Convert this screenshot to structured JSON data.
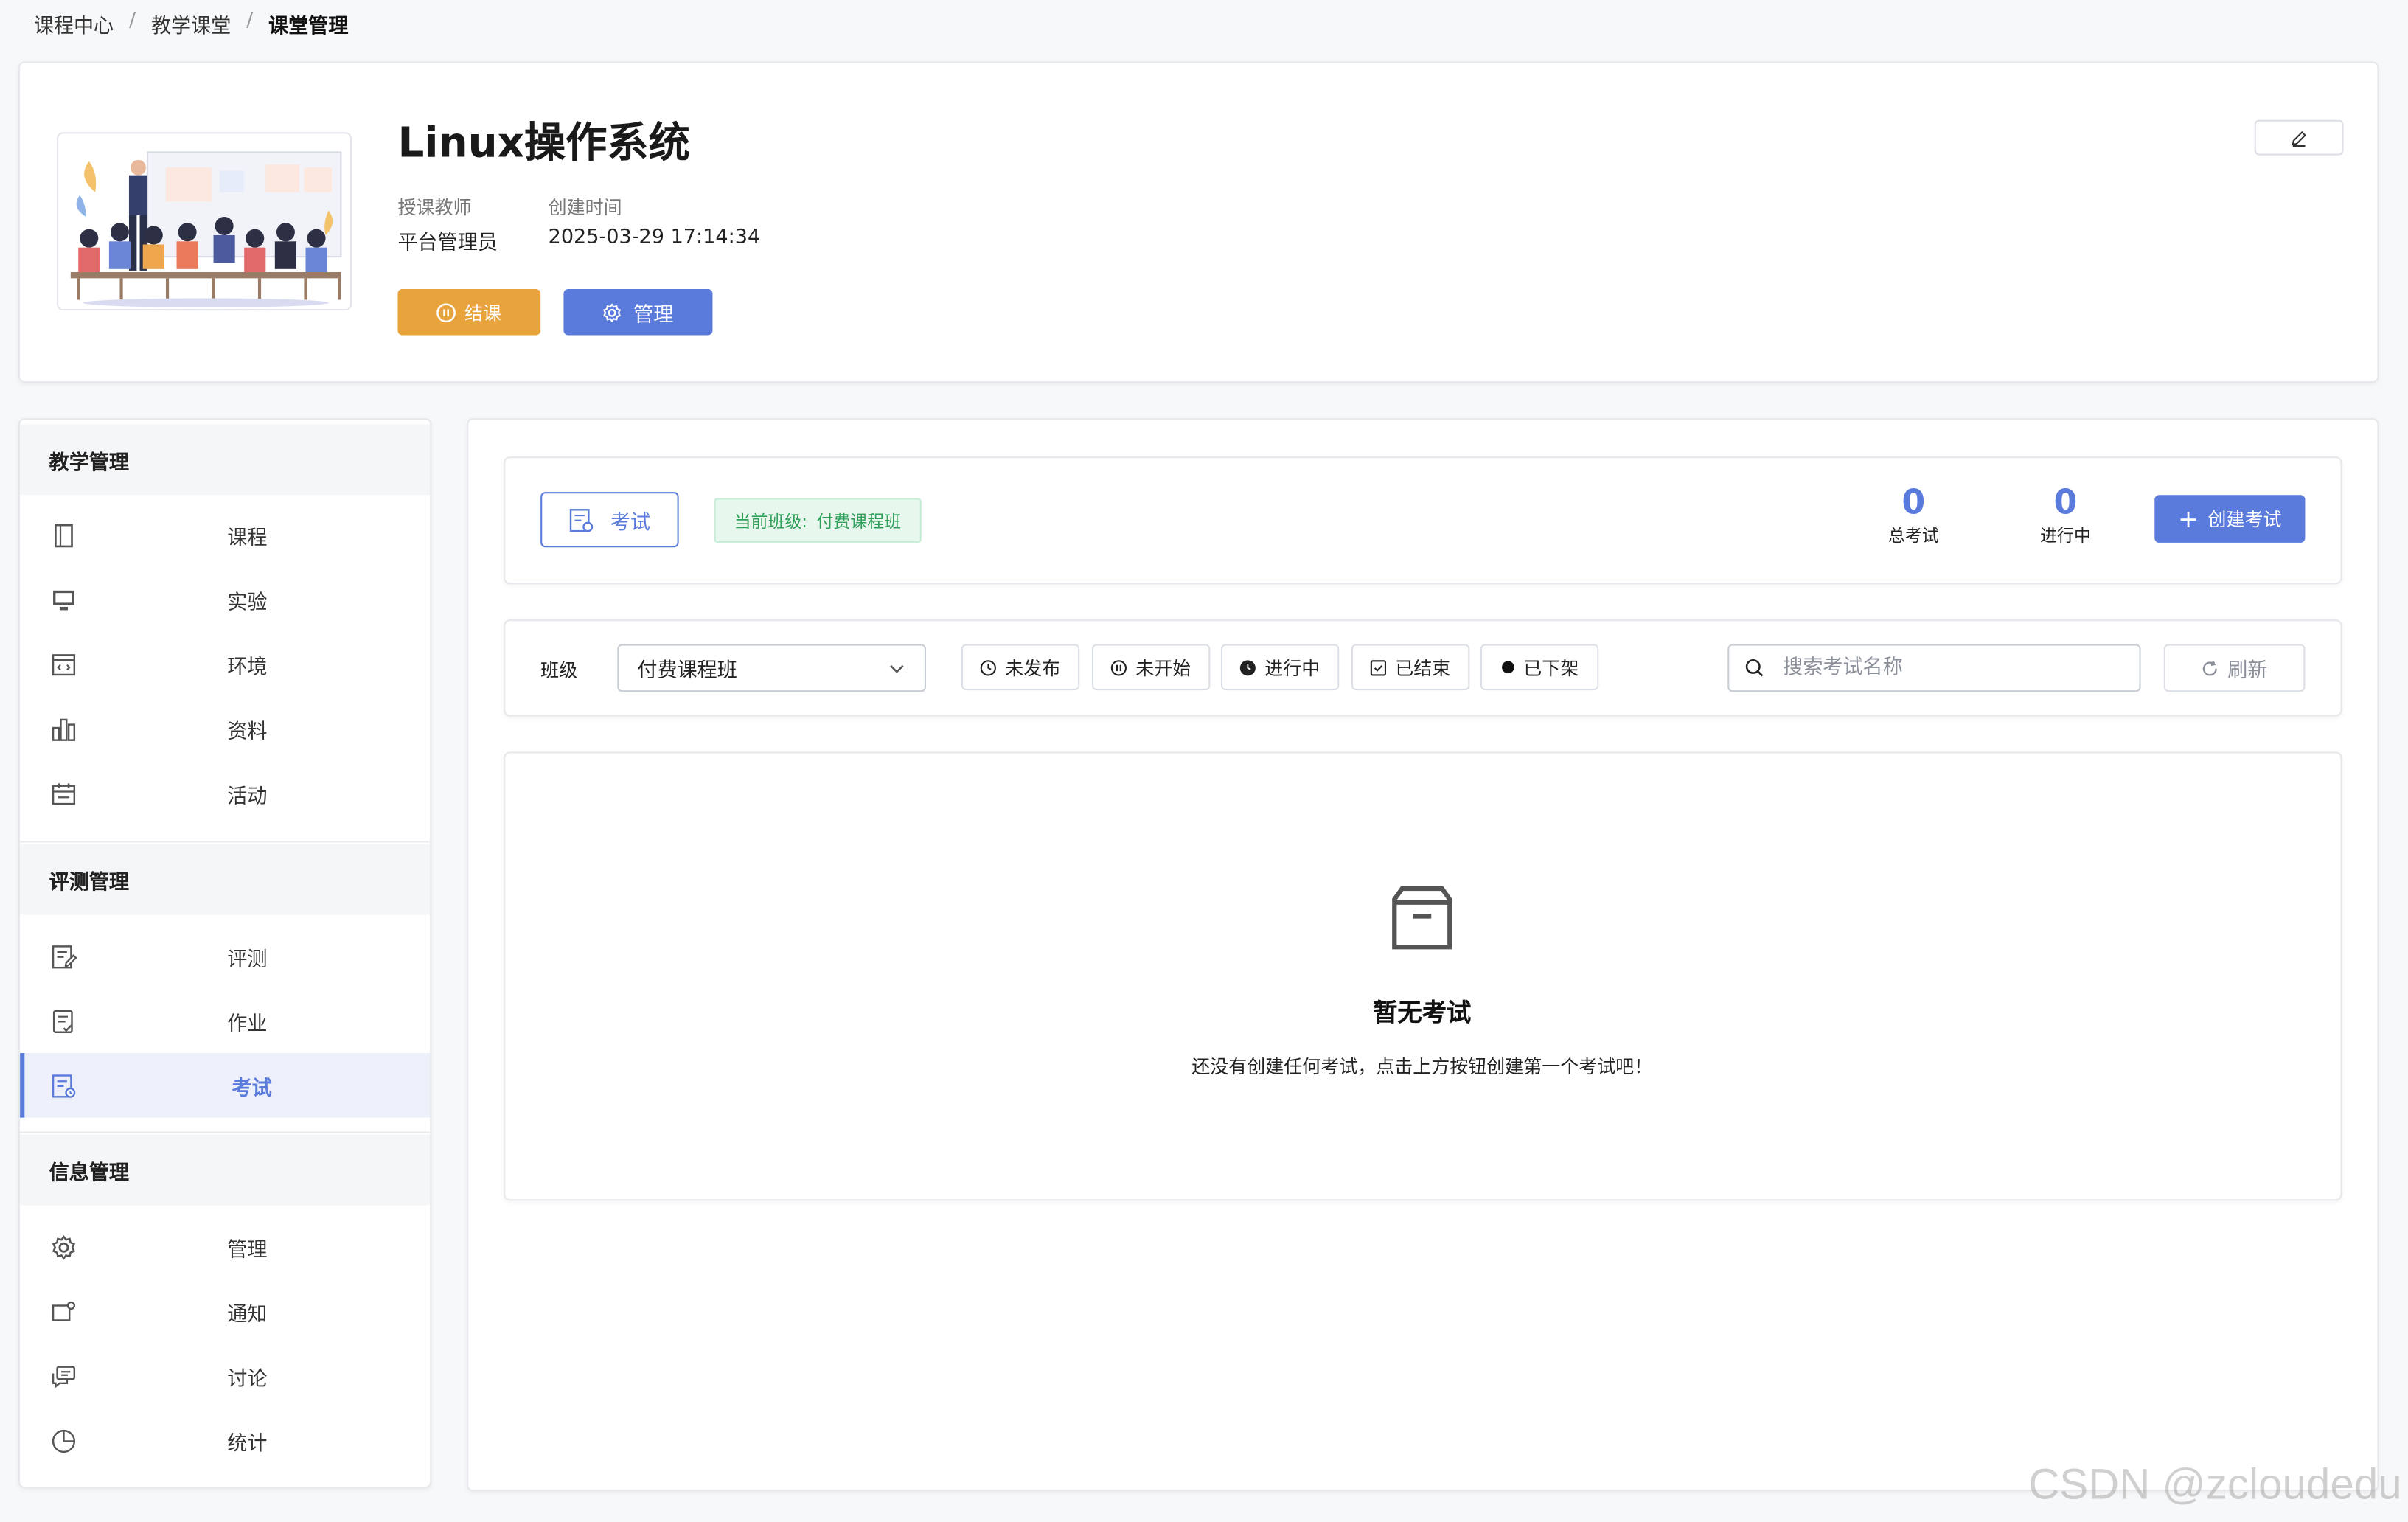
{
  "breadcrumb": [
    "课程中心",
    "教学课堂",
    "课堂管理"
  ],
  "course": {
    "title": "Linux操作系统",
    "teacher_label": "授课教师",
    "teacher": "平台管理员",
    "created_label": "创建时间",
    "created": "2025-03-29 17:14:34",
    "end_button": "结课",
    "manage_button": "管理"
  },
  "sidebar": {
    "sections": [
      {
        "title": "教学管理",
        "items": [
          {
            "label": "课程",
            "icon": "book-icon"
          },
          {
            "label": "实验",
            "icon": "monitor-icon"
          },
          {
            "label": "环境",
            "icon": "code-window-icon"
          },
          {
            "label": "资料",
            "icon": "bar-chart-icon"
          },
          {
            "label": "活动",
            "icon": "calendar-icon"
          }
        ]
      },
      {
        "title": "评测管理",
        "items": [
          {
            "label": "评测",
            "icon": "edit-doc-icon"
          },
          {
            "label": "作业",
            "icon": "check-doc-icon"
          },
          {
            "label": "考试",
            "icon": "exam-icon",
            "active": true
          }
        ]
      },
      {
        "title": "信息管理",
        "items": [
          {
            "label": "管理",
            "icon": "gear-icon"
          },
          {
            "label": "通知",
            "icon": "notification-icon"
          },
          {
            "label": "讨论",
            "icon": "chat-icon"
          },
          {
            "label": "统计",
            "icon": "pie-chart-icon"
          }
        ]
      }
    ]
  },
  "exam_panel": {
    "tab_label": "考试",
    "current_class_label": "当前班级:",
    "current_class": "付费课程班",
    "stats": [
      {
        "value": "0",
        "label": "总考试"
      },
      {
        "value": "0",
        "label": "进行中"
      }
    ],
    "create_button": "创建考试"
  },
  "filters": {
    "class_label": "班级",
    "class_selected": "付费课程班",
    "statuses": [
      "未发布",
      "未开始",
      "进行中",
      "已结束",
      "已下架"
    ],
    "search_placeholder": "搜索考试名称",
    "refresh_label": "刷新"
  },
  "empty_state": {
    "title": "暂无考试",
    "message": "还没有创建任何考试，点击上方按钮创建第一个考试吧！"
  },
  "watermark": "CSDN @zcloudedu",
  "colors": {
    "primary": "#5b7bdc",
    "warning": "#e8a33d",
    "success": "#2fa05a"
  }
}
